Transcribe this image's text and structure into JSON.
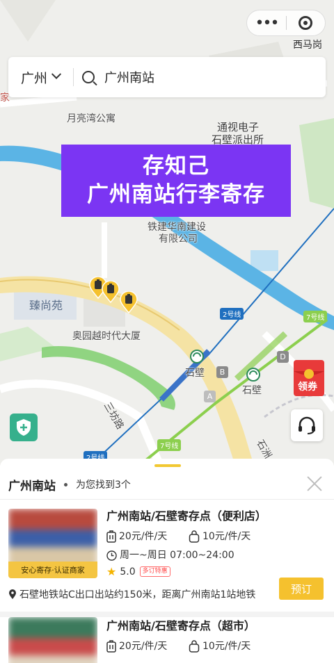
{
  "app": {
    "location_label": "西马岗"
  },
  "search": {
    "city": "广州",
    "query": "广州南站"
  },
  "promo": {
    "line1": "存知己",
    "line2": "广州南站行李寄存"
  },
  "map": {
    "labels": {
      "moonbay": "月亮湾公寓",
      "tongshi1": "通视电子",
      "police": "石壁派出所",
      "tiejian1": "铁建华南建设",
      "tiejian2": "有限公司",
      "zhenshangyuan": "臻尚苑",
      "aoyuan": "奥园越时代大厦",
      "shibi1": "石壁",
      "shibi2": "石壁",
      "sanfang": "三坊路",
      "line2a": "2号线",
      "line2b": "2号线",
      "line7a": "7号线",
      "line7b": "7号线",
      "exitA": "A",
      "exitB": "B",
      "exitD": "D",
      "edge_jia": "家",
      "edge_shi": "石洲"
    },
    "hongbao_label": "领券"
  },
  "sheet": {
    "title": "广州南站",
    "count_text": "为您找到3个",
    "items": [
      {
        "name": "广州南站/石壁寄存点（便利店）",
        "price_bag": "20元/件/天",
        "price_small": "10元/件/天",
        "hours": "周一~周日 07:00~24:00",
        "rating": "5.0",
        "badge": "多订特惠",
        "tag": "安心寄存·认证商家",
        "address": "石壁地铁站C出口出站约150米，距离广州南站1站地铁",
        "book_label": "预订",
        "thumb_colors": [
          "#b84a3e",
          "#3c5fa8",
          "#d9c7a6"
        ]
      },
      {
        "name": "广州南站/石壁寄存点（超市）",
        "price_bag": "20元/件/天",
        "price_small": "10元/件/天",
        "thumb_colors": [
          "#3c7a5c",
          "#c94b4b",
          "#e0d4c0"
        ]
      }
    ]
  },
  "colors": {
    "accent": "#f5c12e",
    "promo": "#7b35f3",
    "river": "#5bb4e5",
    "metro_line2": "#1f6fbf",
    "metro_line7": "#8ccf4e"
  }
}
